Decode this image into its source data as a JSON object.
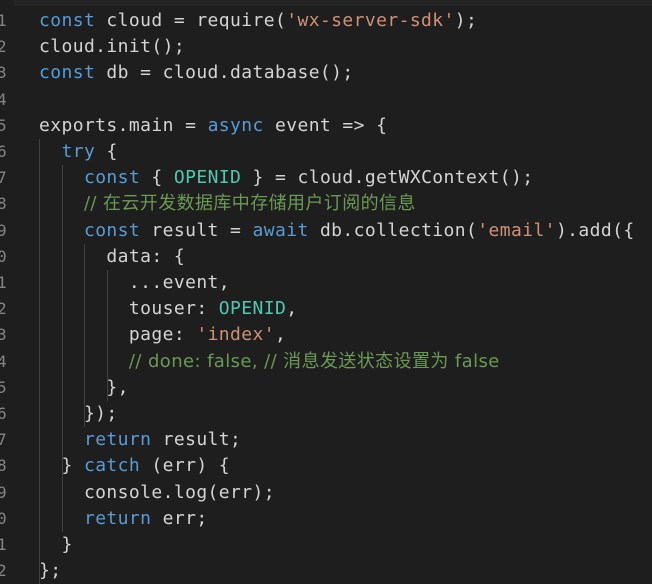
{
  "editor": {
    "line_numbers": [
      "1",
      "2",
      "3",
      "4",
      "5",
      "6",
      "7",
      "8",
      "9",
      "0",
      "1",
      "2",
      "3",
      "4",
      "5",
      "6",
      "7",
      "8",
      "9",
      "0",
      "1",
      "2"
    ],
    "colors": {
      "background": "#1e1e1e",
      "keyword": "#569cd6",
      "string": "#ce9178",
      "comment": "#6a9955",
      "constant": "#4ec9b0",
      "text": "#d4d4d4",
      "line_number": "#858585"
    },
    "lines": [
      [
        {
          "t": "kw",
          "v": "const"
        },
        {
          "t": "plain",
          "v": " cloud = require("
        },
        {
          "t": "str",
          "v": "'wx-server-sdk'"
        },
        {
          "t": "plain",
          "v": ");"
        }
      ],
      [
        {
          "t": "plain",
          "v": "cloud.init();"
        }
      ],
      [
        {
          "t": "kw",
          "v": "const"
        },
        {
          "t": "plain",
          "v": " db = cloud.database();"
        }
      ],
      [],
      [
        {
          "t": "plain",
          "v": "exports.main = "
        },
        {
          "t": "kw",
          "v": "async"
        },
        {
          "t": "plain",
          "v": " event => {"
        }
      ],
      [
        {
          "t": "plain",
          "v": "  "
        },
        {
          "t": "kw",
          "v": "try"
        },
        {
          "t": "plain",
          "v": " {"
        }
      ],
      [
        {
          "t": "plain",
          "v": "    "
        },
        {
          "t": "kw",
          "v": "const"
        },
        {
          "t": "plain",
          "v": " { "
        },
        {
          "t": "const",
          "v": "OPENID"
        },
        {
          "t": "plain",
          "v": " } = cloud.getWXContext();"
        }
      ],
      [
        {
          "t": "plain",
          "v": "    "
        },
        {
          "t": "cmt",
          "v": "// 在云开发数据库中存储用户订阅的信息"
        }
      ],
      [
        {
          "t": "plain",
          "v": "    "
        },
        {
          "t": "kw",
          "v": "const"
        },
        {
          "t": "plain",
          "v": " result = "
        },
        {
          "t": "kw",
          "v": "await"
        },
        {
          "t": "plain",
          "v": " db.collection("
        },
        {
          "t": "str",
          "v": "'email'"
        },
        {
          "t": "plain",
          "v": ").add({"
        }
      ],
      [
        {
          "t": "plain",
          "v": "      data: {"
        }
      ],
      [
        {
          "t": "plain",
          "v": "        ...event,"
        }
      ],
      [
        {
          "t": "plain",
          "v": "        touser: "
        },
        {
          "t": "const",
          "v": "OPENID"
        },
        {
          "t": "plain",
          "v": ","
        }
      ],
      [
        {
          "t": "plain",
          "v": "        page: "
        },
        {
          "t": "str",
          "v": "'index'"
        },
        {
          "t": "plain",
          "v": ","
        }
      ],
      [
        {
          "t": "plain",
          "v": "        "
        },
        {
          "t": "cmt",
          "v": "// done: false, // 消息发送状态设置为 false"
        }
      ],
      [
        {
          "t": "plain",
          "v": "      },"
        }
      ],
      [
        {
          "t": "plain",
          "v": "    });"
        }
      ],
      [
        {
          "t": "plain",
          "v": "    "
        },
        {
          "t": "kw",
          "v": "return"
        },
        {
          "t": "plain",
          "v": " result;"
        }
      ],
      [
        {
          "t": "plain",
          "v": "  } "
        },
        {
          "t": "kw",
          "v": "catch"
        },
        {
          "t": "plain",
          "v": " (err) {"
        }
      ],
      [
        {
          "t": "plain",
          "v": "    console.log(err);"
        }
      ],
      [
        {
          "t": "plain",
          "v": "    "
        },
        {
          "t": "kw",
          "v": "return"
        },
        {
          "t": "plain",
          "v": " err;"
        }
      ],
      [
        {
          "t": "plain",
          "v": "  }"
        }
      ],
      [
        {
          "t": "plain",
          "v": "};"
        }
      ]
    ]
  }
}
